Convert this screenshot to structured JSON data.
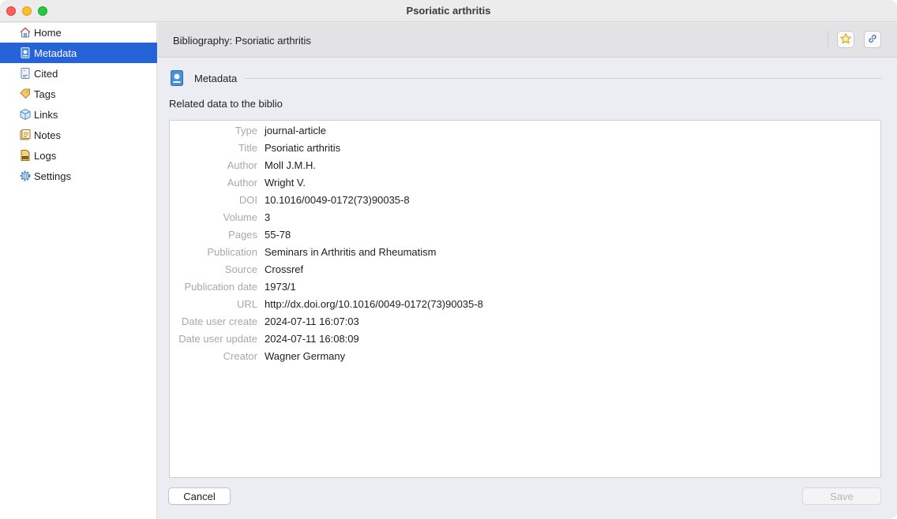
{
  "window": {
    "title": "Psoriatic arthritis"
  },
  "sidebar": {
    "items": [
      {
        "label": "Home",
        "icon": "home-icon"
      },
      {
        "label": "Metadata",
        "icon": "metadata-icon",
        "active": true
      },
      {
        "label": "Cited",
        "icon": "cited-icon"
      },
      {
        "label": "Tags",
        "icon": "tag-icon"
      },
      {
        "label": "Links",
        "icon": "cube-icon"
      },
      {
        "label": "Notes",
        "icon": "notes-icon"
      },
      {
        "label": "Logs",
        "icon": "logs-icon"
      },
      {
        "label": "Settings",
        "icon": "gear-icon"
      }
    ]
  },
  "header": {
    "title": "Bibliography: Psoriatic arthritis",
    "actions": [
      "star-icon",
      "link-icon"
    ]
  },
  "section": {
    "label": "Metadata",
    "subtitle": "Related data to the biblio"
  },
  "metadata": [
    {
      "key": "Type",
      "value": "journal-article"
    },
    {
      "key": "Title",
      "value": "Psoriatic arthritis"
    },
    {
      "key": "Author",
      "value": "Moll J.M.H."
    },
    {
      "key": "Author",
      "value": "Wright V."
    },
    {
      "key": "DOI",
      "value": "10.1016/0049-0172(73)90035-8"
    },
    {
      "key": "Volume",
      "value": "3"
    },
    {
      "key": "Pages",
      "value": "55-78"
    },
    {
      "key": "Publication",
      "value": "Seminars in Arthritis and Rheumatism"
    },
    {
      "key": "Source",
      "value": "Crossref"
    },
    {
      "key": "Publication date",
      "value": "1973/1"
    },
    {
      "key": "URL",
      "value": "http://dx.doi.org/10.1016/0049-0172(73)90035-8"
    },
    {
      "key": "Date user create",
      "value": "2024-07-11 16:07:03"
    },
    {
      "key": "Date user update",
      "value": "2024-07-11 16:08:09"
    },
    {
      "key": "Creator",
      "value": "Wagner Germany"
    }
  ],
  "buttons": {
    "cancel": "Cancel",
    "save": "Save"
  },
  "colors": {
    "accent": "#2663d9",
    "key_text": "#a8a8a8"
  }
}
